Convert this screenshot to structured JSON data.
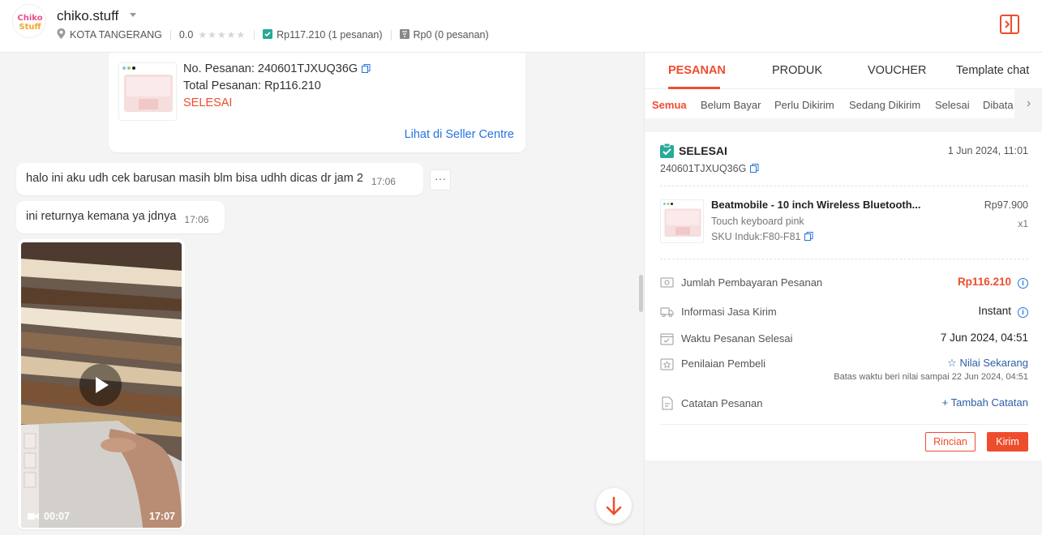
{
  "header": {
    "shop_name": "chiko.stuff",
    "logo_text_top": "Chiko",
    "logo_text_bottom": "Stuff",
    "location": "KOTA TANGERANG",
    "rating": "0.0",
    "total_purchase": "Rp117.210 (1 pesanan)",
    "total_return": "Rp0 (0 pesanan)"
  },
  "chat": {
    "order_card": {
      "order_no": "No. Pesanan: 240601TJXUQ36G",
      "total": "Total Pesanan: Rp116.210",
      "status": "SELESAI",
      "link": "Lihat di Seller Centre"
    },
    "messages": [
      {
        "text": "halo ini aku udh cek barusan masih blm bisa udhh dicas dr jam 2",
        "time": "17:06"
      },
      {
        "text": "ini returnya kemana ya jdnya",
        "time": "17:06"
      }
    ],
    "more_label": "···",
    "video": {
      "duration": "00:07",
      "time": "17:07"
    }
  },
  "panel": {
    "tabs": [
      "PESANAN",
      "PRODUK",
      "VOUCHER",
      "Template chat"
    ],
    "subtabs": [
      "Semua",
      "Belum Bayar",
      "Perlu Dikirim",
      "Sedang Dikirim",
      "Selesai",
      "Dibata"
    ],
    "order": {
      "status": "SELESAI",
      "date": "1 Jun 2024, 11:01",
      "id": "240601TJXUQ36G",
      "product": {
        "name": "Beatmobile - 10 inch Wireless Bluetooth...",
        "variant": "Touch keyboard pink",
        "sku": "SKU Induk:F80-F81",
        "price": "Rp97.900",
        "qty": "x1"
      },
      "payment_label": "Jumlah Pembayaran Pesanan",
      "payment_value": "Rp116.210",
      "shipping_label": "Informasi Jasa Kirim",
      "shipping_value": "Instant",
      "completed_label": "Waktu Pesanan Selesai",
      "completed_value": "7 Jun 2024, 04:51",
      "rating_label": "Penilaian Pembeli",
      "rating_value": "Nilai Sekarang",
      "rating_note": "Batas waktu beri nilai sampai 22 Jun 2024, 04:51",
      "note_label": "Catatan Pesanan",
      "note_value": "Tambah Catatan",
      "btn_rincian": "Rincian",
      "btn_kirim": "Kirim"
    }
  },
  "colors": {
    "accent": "#ee4d2d",
    "link": "#2673dd",
    "success": "#26aa99"
  }
}
